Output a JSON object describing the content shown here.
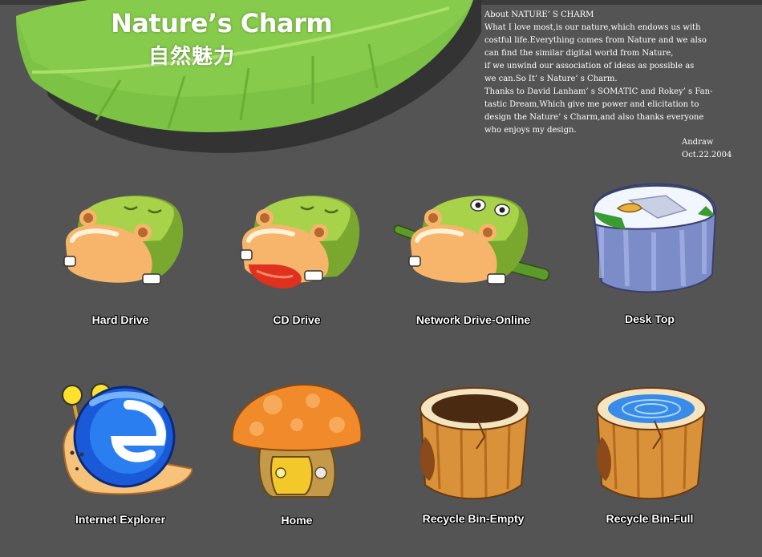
{
  "header": {
    "title": "Nature’s Charm",
    "subtitle": "自然魅力"
  },
  "about": {
    "lines": [
      "About NATURE’ S CHARM",
      "What I love most,is our nature,which endows us with",
      "costful life.Everything comes from Nature and we also",
      "can find the similar digital world from Nature,",
      "if we unwind our association of ideas as possible as",
      "we can.So It’ s Nature’ s Charm.",
      "Thanks to David Lanham’ s SOMATIC and Rokey’ s Fan-",
      "tastic Dream,Which give me power and elicitation to",
      "design the Nature’ s Charm,and also thanks everyone",
      "who enjoys my design."
    ],
    "author": "Andraw",
    "date": "Oct.22.2004"
  },
  "icons": [
    {
      "label": "Hard Drive",
      "icon": "hippo-sleeping-icon"
    },
    {
      "label": "CD Drive",
      "icon": "hippo-tongue-icon"
    },
    {
      "label": "Network Drive-Online",
      "icon": "hippo-bamboo-icon"
    },
    {
      "label": "Desk Top",
      "icon": "rock-pond-icon"
    },
    {
      "label": "Internet Explorer",
      "icon": "snail-icon"
    },
    {
      "label": "Home",
      "icon": "mushroom-house-icon"
    },
    {
      "label": "Recycle Bin-Empty",
      "icon": "tree-stump-empty-icon"
    },
    {
      "label": "Recycle Bin-Full",
      "icon": "tree-stump-water-icon"
    }
  ],
  "colors": {
    "background": "#545454",
    "leaf": "#7cc245",
    "leaf_shadow": "#3a3a3a",
    "text": "#ffffff"
  }
}
